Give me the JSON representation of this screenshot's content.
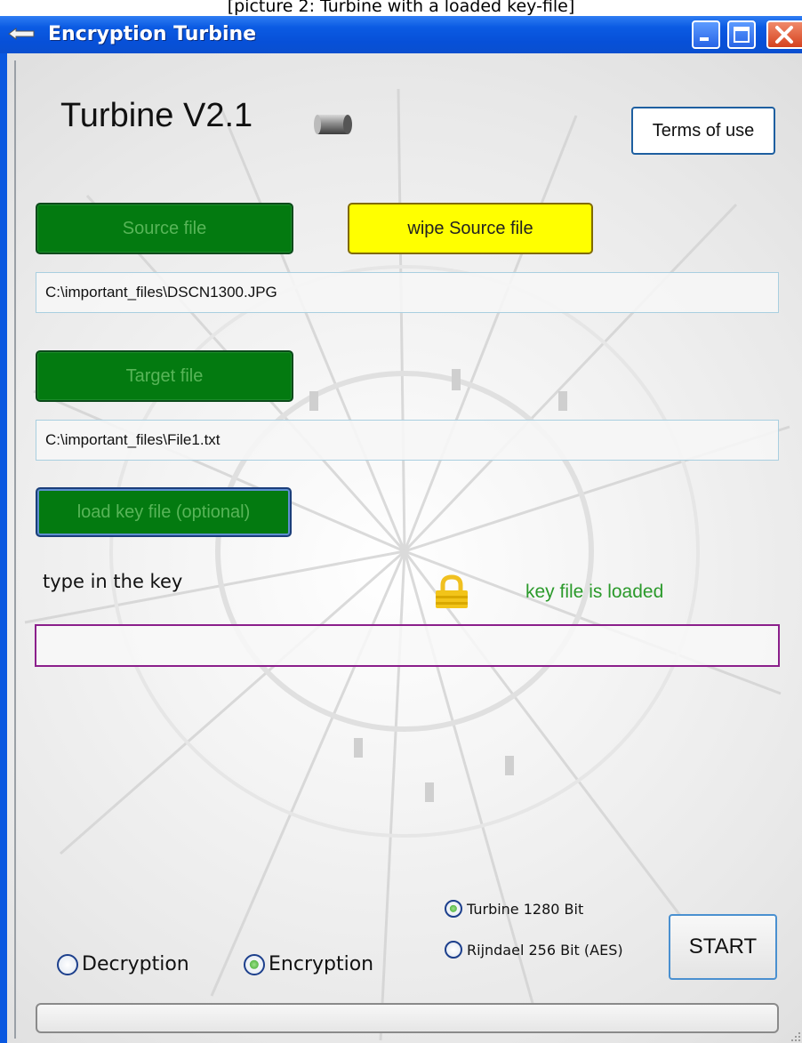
{
  "caption": "[picture 2: Turbine with a loaded key-file]",
  "window": {
    "title": "Encryption Turbine"
  },
  "app": {
    "title": "Turbine V2.1"
  },
  "buttons": {
    "terms": "Terms of use",
    "source": "Source file",
    "wipe": "wipe Source file",
    "target": "Target file",
    "load_key": "load key file (optional)",
    "start": "START"
  },
  "fields": {
    "source_path": "C:\\important_files\\DSCN1300.JPG",
    "target_path": "C:\\important_files\\File1.txt",
    "key_value": ""
  },
  "key": {
    "label": "type in the key",
    "status": "key file is loaded"
  },
  "algorithms": [
    {
      "label": "Turbine 1280 Bit",
      "selected": true
    },
    {
      "label": "Rijndael 256 Bit (AES)",
      "selected": false
    }
  ],
  "modes": [
    {
      "label": "Decryption",
      "selected": false
    },
    {
      "label": "Encryption",
      "selected": true
    }
  ],
  "progress": 0,
  "icons": {
    "app_icon": "arrow-left-icon",
    "logo": "cylinder-icon",
    "lock": "padlock-icon"
  },
  "colors": {
    "titlebar": "#0a58e0",
    "green_button": "#037a10",
    "green_text": "#58b558",
    "wipe_button": "#ffff00",
    "status_green": "#2b9a2b",
    "key_border": "#8b1f8b"
  }
}
